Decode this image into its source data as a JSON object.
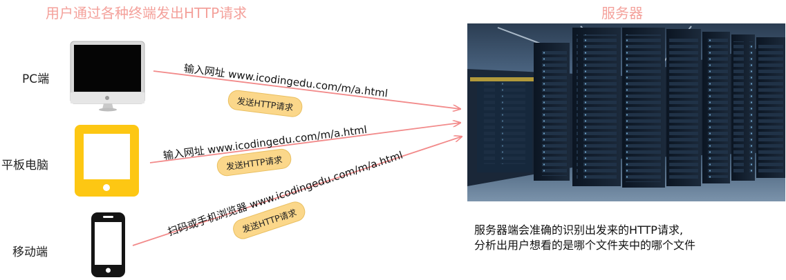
{
  "titles": {
    "left": "用户通过各种终端发出HTTP请求",
    "right": "服务器"
  },
  "devices": [
    {
      "label": "PC端",
      "icon": "desktop-monitor-icon",
      "url_text": "输入网址 www.icodingedu.com/m/a.html",
      "pill": "发送HTTP请求"
    },
    {
      "label": "平板电脑",
      "icon": "tablet-icon",
      "url_text": "输入网址 www.icodingedu.com/m/a.html",
      "pill": "发送HTTP请求"
    },
    {
      "label": "移动端",
      "icon": "smartphone-icon",
      "url_text": "扫码或手机浏览器 www.icodingedu.com/m/a.html",
      "pill": "发送HTTP请求"
    }
  ],
  "server_note": {
    "line1": "服务器端会准确的识别出发来的HTTP请求,",
    "line2": "分析出用户想看的是哪个文件夹中的哪个文件"
  },
  "colors": {
    "heading": "#f4a19b",
    "arrow": "#f28a8a",
    "tablet": "#fdc713",
    "pill": "#fbd78a"
  }
}
